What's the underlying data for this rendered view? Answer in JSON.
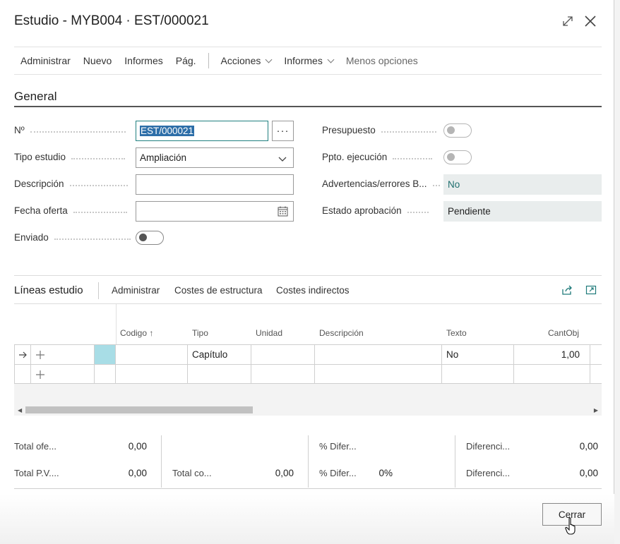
{
  "window": {
    "title": "Estudio - MYB004 · EST/000021",
    "expand_icon": "expand-diagonal-icon",
    "close_icon": "close-icon"
  },
  "actionbar": {
    "items": [
      "Administrar",
      "Nuevo",
      "Informes",
      "Pág."
    ],
    "menus": [
      "Acciones",
      "Informes"
    ],
    "less_options": "Menos opciones"
  },
  "general": {
    "title": "General",
    "no_label": "Nº",
    "no_value": "EST/000021",
    "lookup_label": "···",
    "tipo_label": "Tipo estudio",
    "tipo_value": "Ampliación",
    "descripcion_label": "Descripción",
    "descripcion_value": "",
    "fecha_label": "Fecha oferta",
    "fecha_value": "",
    "enviado_label": "Enviado",
    "enviado_value": false,
    "presupuesto_label": "Presupuesto",
    "presupuesto_value": false,
    "ppto_label": "Ppto. ejecución",
    "ppto_value": false,
    "advertencias_label": "Advertencias/errores B...",
    "advertencias_value": "No",
    "estado_label": "Estado aprobación",
    "estado_value": "Pendiente"
  },
  "lineas": {
    "title": "Líneas estudio",
    "actions": [
      "Administrar",
      "Costes de estructura",
      "Costes indirectos"
    ],
    "share_icon": "share-icon",
    "expand_icon": "expand-icon",
    "columns": [
      "Codigo ↑",
      "Tipo",
      "Unidad",
      "Descripción",
      "Texto",
      "CantObj"
    ],
    "rows": [
      {
        "codigo": "",
        "tipo": "Capítulo",
        "unidad": "",
        "descripcion": "",
        "texto": "No",
        "cantobj": "1,00"
      },
      {
        "codigo": "",
        "tipo": "",
        "unidad": "",
        "descripcion": "",
        "texto": "",
        "cantobj": ""
      }
    ]
  },
  "totals": {
    "total_oferta_label": "Total ofe...",
    "total_oferta_value": "0,00",
    "total_pv_label": "Total P.V....",
    "total_pv_value": "0,00",
    "total_co_label": "Total co...",
    "total_co_value": "0,00",
    "pct_dif1_label": "% Difer...",
    "pct_dif2_label": "% Difer...",
    "pct_dif2_value": "0%",
    "diferencia1_label": "Diferenci...",
    "diferencia1_value": "0,00",
    "diferencia2_label": "Diferenci...",
    "diferencia2_value": "0,00"
  },
  "footer": {
    "close_label": "Cerrar"
  },
  "colors": {
    "accent": "#208080",
    "selection": "#2d6ea8",
    "readonly_bg": "#e9eded",
    "row_marker": "#a8dde6"
  }
}
